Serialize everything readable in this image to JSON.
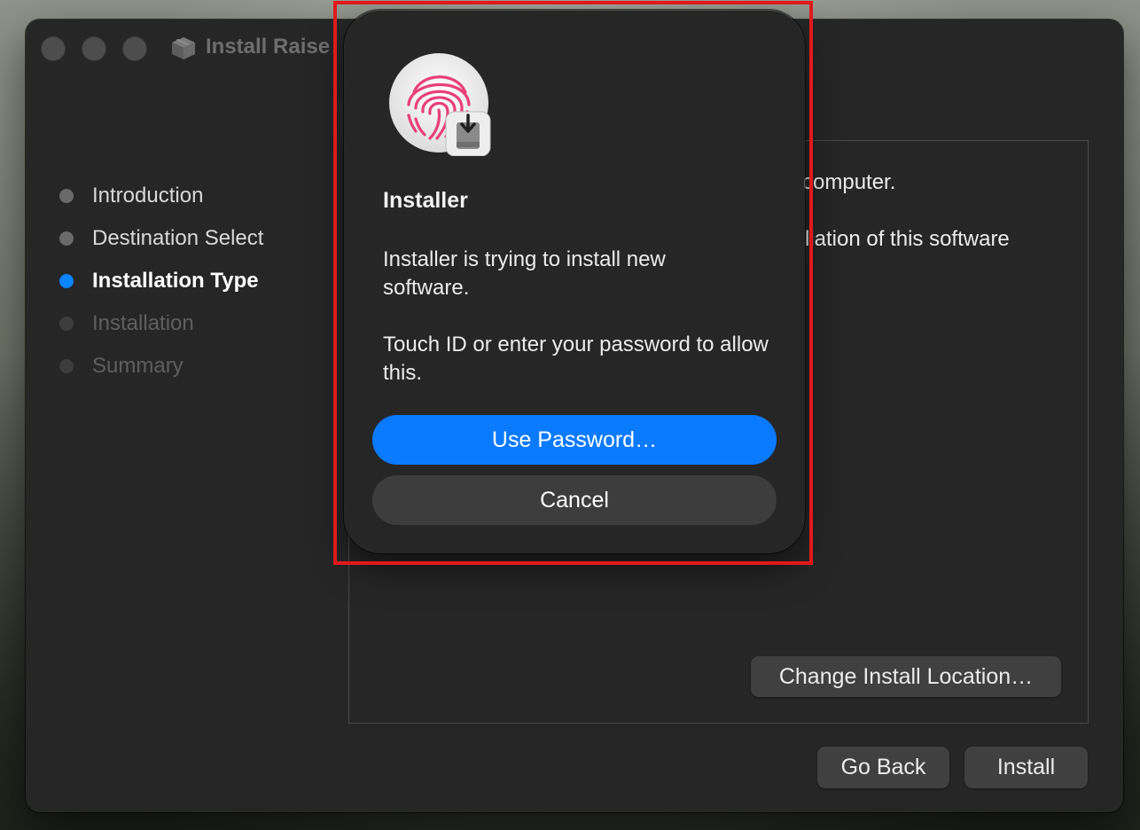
{
  "window": {
    "title": "Install Raise"
  },
  "sidebar": {
    "steps": [
      {
        "label": "Introduction",
        "state": "done"
      },
      {
        "label": "Destination Select",
        "state": "done"
      },
      {
        "label": "Installation Type",
        "state": "active"
      },
      {
        "label": "Installation",
        "state": "pending"
      },
      {
        "label": "Summary",
        "state": "pending"
      }
    ]
  },
  "main": {
    "partial_text_1": "computer.",
    "partial_text_2": "llation of this software",
    "change_location_button": "Change Install Location…"
  },
  "footer": {
    "go_back_button": "Go Back",
    "install_button": "Install"
  },
  "auth_dialog": {
    "title": "Installer",
    "message_1": "Installer is trying to install new software.",
    "message_2": "Touch ID or enter your password to allow this.",
    "use_password_button": "Use Password…",
    "cancel_button": "Cancel",
    "icon": "touch-id-fingerprint-icon"
  },
  "colors": {
    "accent": "#0a84ff",
    "highlight": "#e0191c",
    "window_bg": "#262626",
    "fingerprint": "#e8407a"
  }
}
